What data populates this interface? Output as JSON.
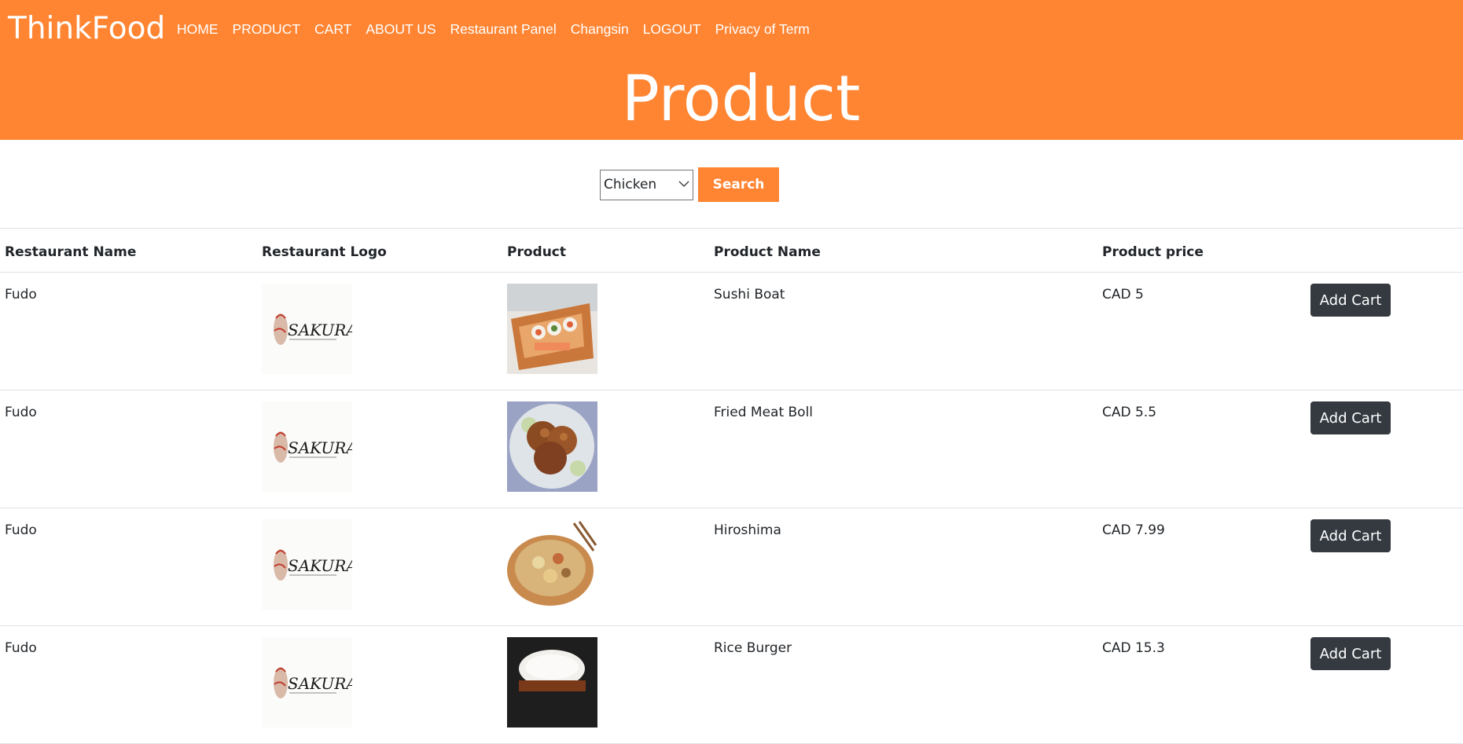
{
  "brand": "ThinkFood",
  "nav": [
    "HOME",
    "PRODUCT",
    "CART",
    "ABOUT US",
    "Restaurant Panel",
    "Changsin",
    "LOGOUT",
    "Privacy of Term"
  ],
  "hero_title": "Product",
  "search": {
    "selected": "Chicken",
    "button_label": "Search"
  },
  "table": {
    "headers": [
      "Restaurant Name",
      "Restaurant Logo",
      "Product",
      "Product Name",
      "Product price"
    ],
    "rows": [
      {
        "restaurant": "Fudo",
        "product_name": "Sushi Boat",
        "price": "CAD 5",
        "button": "Add Cart",
        "logo_text": "SAKURA",
        "food_icon": "sushi-boat-image"
      },
      {
        "restaurant": "Fudo",
        "product_name": "Fried Meat Boll",
        "price": "CAD 5.5",
        "button": "Add Cart",
        "logo_text": "SAKURA",
        "food_icon": "fried-meatball-image"
      },
      {
        "restaurant": "Fudo",
        "product_name": "Hiroshima",
        "price": "CAD 7.99",
        "button": "Add Cart",
        "logo_text": "SAKURA",
        "food_icon": "okonomiyaki-image"
      },
      {
        "restaurant": "Fudo",
        "product_name": "Rice Burger",
        "price": "CAD 15.3",
        "button": "Add Cart",
        "logo_text": "SAKURA",
        "food_icon": "rice-burger-image"
      }
    ]
  },
  "colors": {
    "header": "#FF8533",
    "button_dark": "#343a40"
  }
}
